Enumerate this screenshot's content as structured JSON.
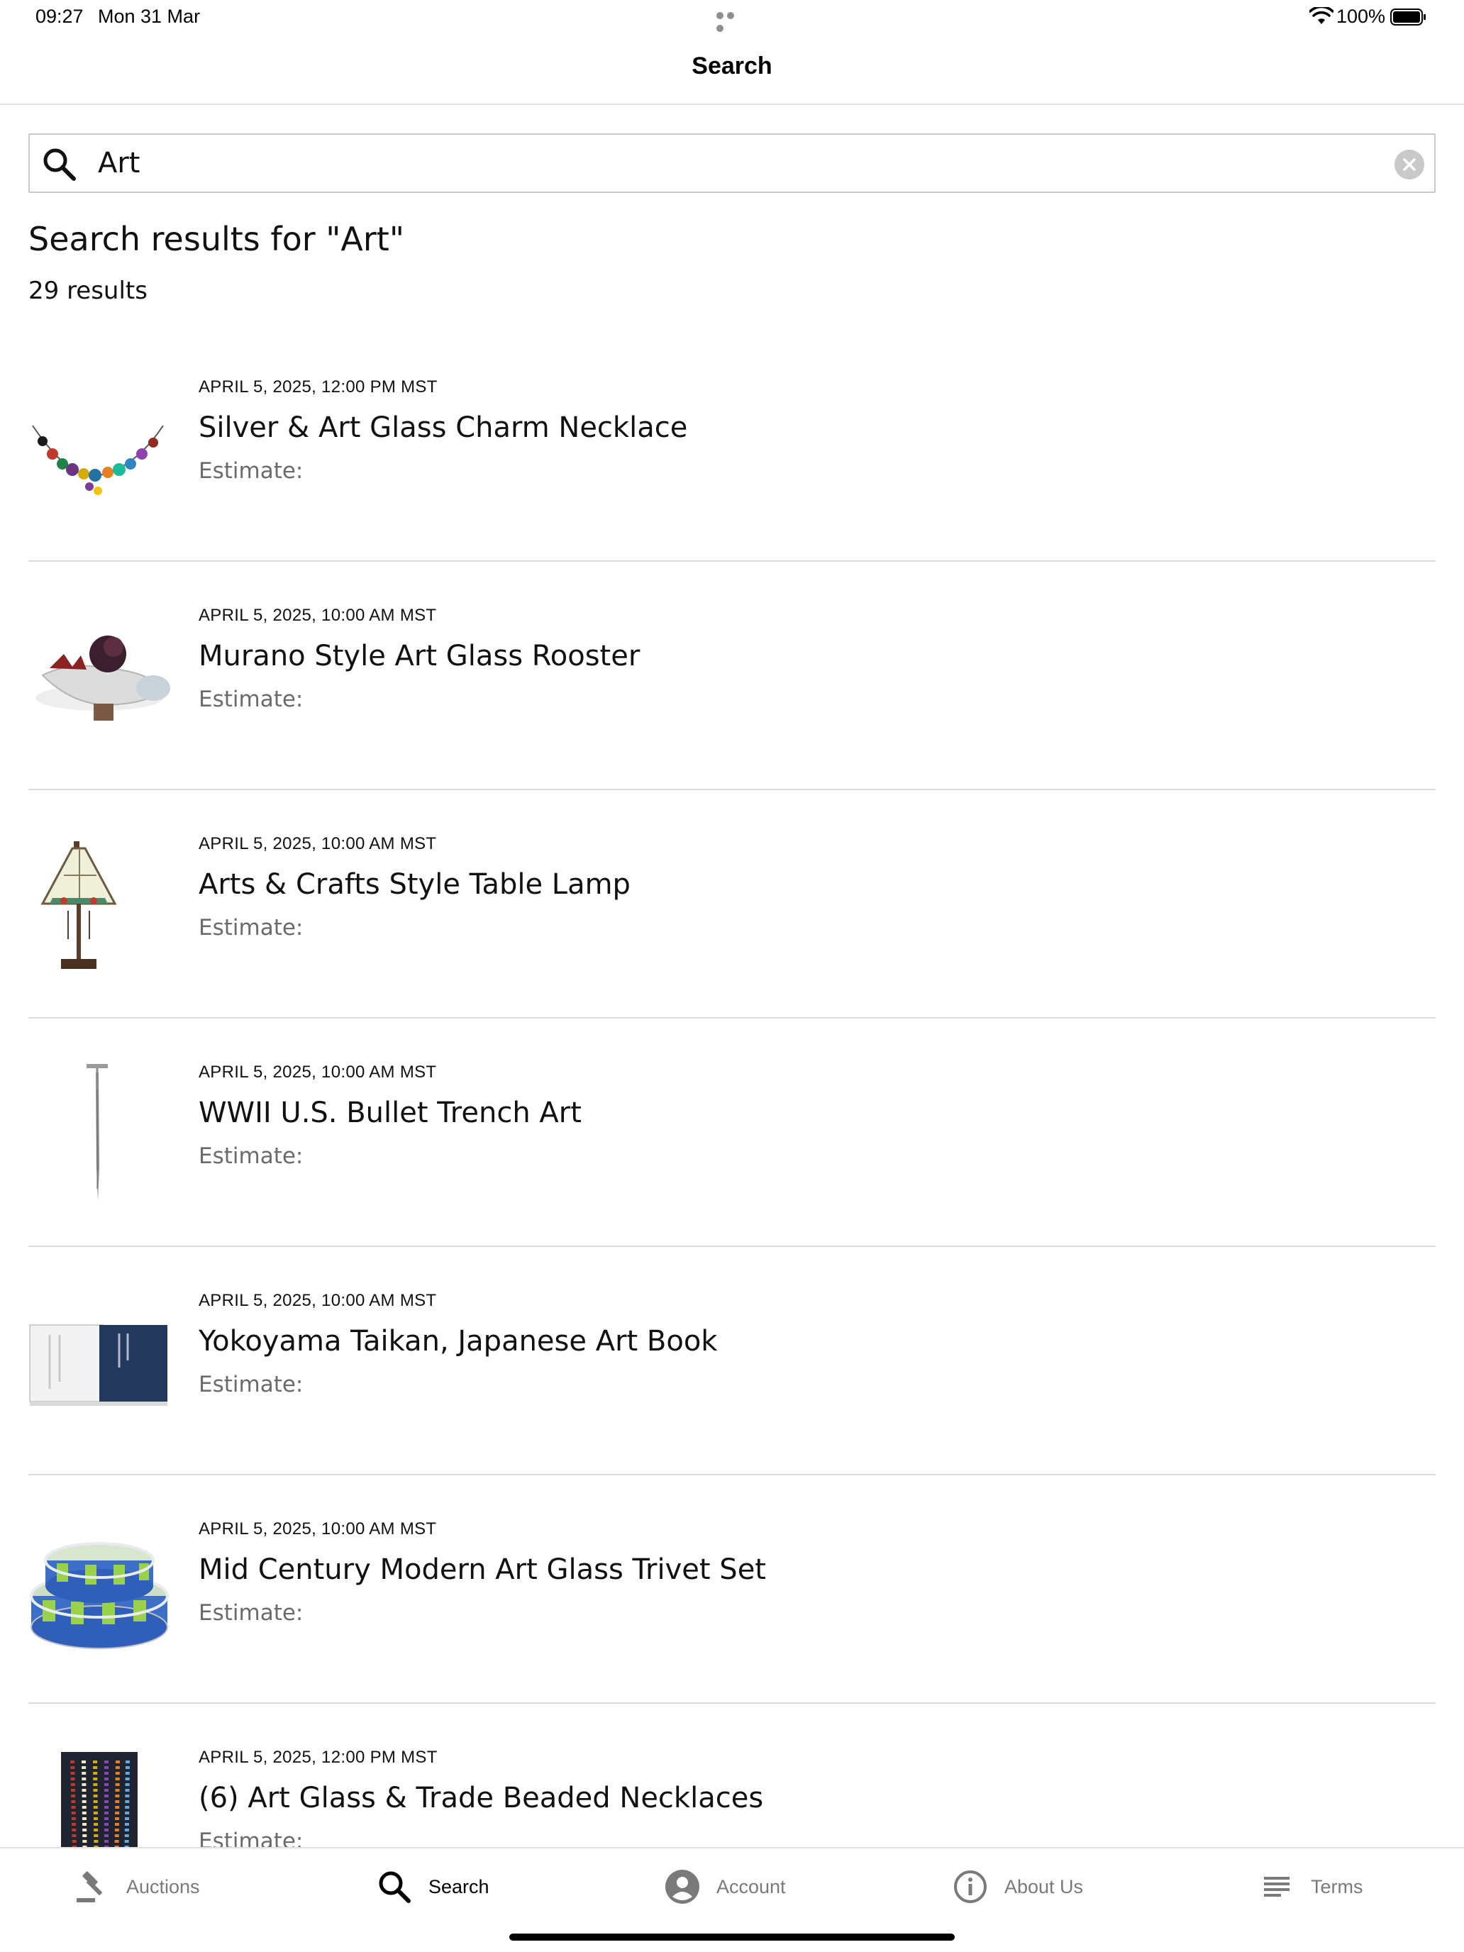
{
  "status_bar": {
    "time": "09:27",
    "date": "Mon 31 Mar",
    "battery_percent": "100%"
  },
  "nav": {
    "title": "Search"
  },
  "search": {
    "query": "Art",
    "heading": "Search results for \"Art\"",
    "result_count": "29 results"
  },
  "results": [
    {
      "date": "APRIL 5, 2025, 12:00 PM MST",
      "title": "Silver & Art Glass Charm Necklace",
      "estimate_label": "Estimate:",
      "thumb_icon": "necklace-thumbnail"
    },
    {
      "date": "APRIL 5, 2025, 10:00 AM MST",
      "title": "Murano Style Art Glass Rooster",
      "estimate_label": "Estimate:",
      "thumb_icon": "rooster-thumbnail"
    },
    {
      "date": "APRIL 5, 2025, 10:00 AM MST",
      "title": "Arts & Crafts Style Table Lamp",
      "estimate_label": "Estimate:",
      "thumb_icon": "lamp-thumbnail"
    },
    {
      "date": "APRIL 5, 2025, 10:00 AM MST",
      "title": "WWII U.S. Bullet Trench Art",
      "estimate_label": "Estimate:",
      "thumb_icon": "trench-art-thumbnail"
    },
    {
      "date": "APRIL 5, 2025, 10:00 AM MST",
      "title": "Yokoyama Taikan, Japanese Art Book",
      "estimate_label": "Estimate:",
      "thumb_icon": "book-thumbnail"
    },
    {
      "date": "APRIL 5, 2025, 10:00 AM MST",
      "title": "Mid Century Modern Art Glass Trivet Set",
      "estimate_label": "Estimate:",
      "thumb_icon": "trivet-thumbnail"
    },
    {
      "date": "APRIL 5, 2025, 12:00 PM MST",
      "title": "(6) Art Glass & Trade Beaded Necklaces",
      "estimate_label": "Estimate:",
      "thumb_icon": "beaded-necklaces-thumbnail"
    }
  ],
  "tab_bar": {
    "tabs": [
      {
        "label": "Auctions",
        "icon": "gavel-icon",
        "active": false
      },
      {
        "label": "Search",
        "icon": "search-icon",
        "active": true
      },
      {
        "label": "Account",
        "icon": "account-icon",
        "active": false
      },
      {
        "label": "About Us",
        "icon": "info-icon",
        "active": false
      },
      {
        "label": "Terms",
        "icon": "list-icon",
        "active": false
      }
    ]
  },
  "colors": {
    "active_tab": "#000000",
    "inactive_tab": "#7a7a7a",
    "divider": "#dcdcdc",
    "estimate_text": "#6b6b6b"
  }
}
